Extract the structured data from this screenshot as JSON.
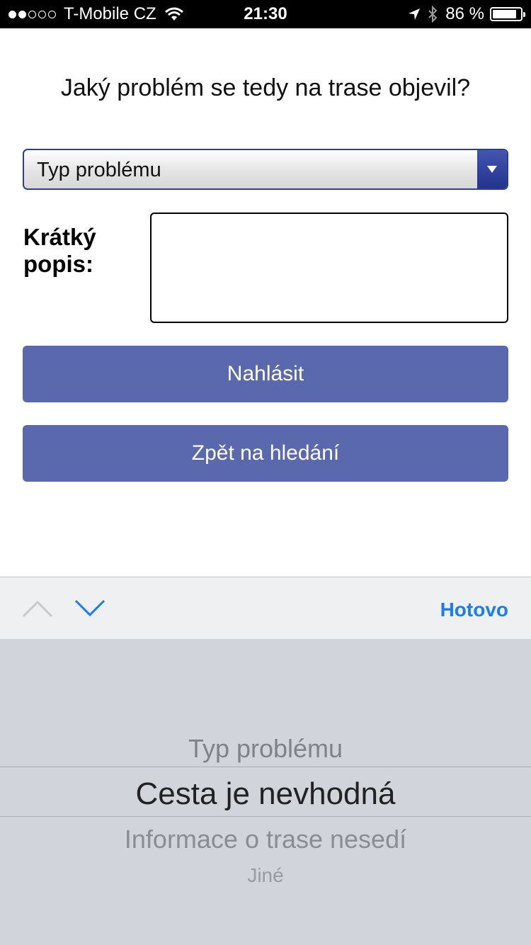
{
  "status_bar": {
    "carrier": "T-Mobile CZ",
    "time": "21:30",
    "battery_text": "86 %",
    "battery_level": 0.86,
    "signal_filled": 2,
    "signal_total": 5,
    "icons": [
      "wifi-icon",
      "location-arrow-icon",
      "bluetooth-icon",
      "battery-icon"
    ]
  },
  "form": {
    "question": "Jaký problém se tedy na trase objevil?",
    "select_value": "Typ problému",
    "description_label": "Krátký popis:",
    "description_value": "",
    "report_button": "Nahlásit",
    "back_button": "Zpět na hledání"
  },
  "keyboard_toolbar": {
    "done_label": "Hotovo",
    "accent_color": "#1a7cf6"
  },
  "picker": {
    "options": [
      "Typ problému",
      "Cesta je nevhodná",
      "Informace o trase nesedí",
      "Jiné"
    ],
    "selected": "Cesta je nevhodná"
  },
  "colors": {
    "button_bg": "#5a69ae",
    "select_border": "#2f3f8f"
  }
}
